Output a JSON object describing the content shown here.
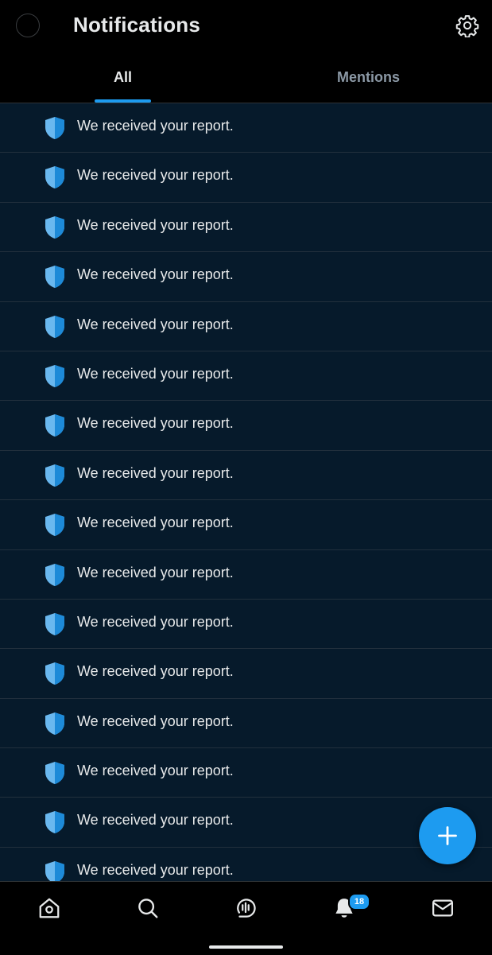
{
  "header": {
    "title": "Notifications",
    "avatar_icon": "profile-avatar-icon",
    "settings_icon": "gear-icon"
  },
  "tabs": [
    {
      "label": "All",
      "active": true
    },
    {
      "label": "Mentions",
      "active": false
    }
  ],
  "notifications": [
    {
      "icon": "shield-icon",
      "text": "We received your report."
    },
    {
      "icon": "shield-icon",
      "text": "We received your report."
    },
    {
      "icon": "shield-icon",
      "text": "We received your report."
    },
    {
      "icon": "shield-icon",
      "text": "We received your report."
    },
    {
      "icon": "shield-icon",
      "text": "We received your report."
    },
    {
      "icon": "shield-icon",
      "text": "We received your report."
    },
    {
      "icon": "shield-icon",
      "text": "We received your report."
    },
    {
      "icon": "shield-icon",
      "text": "We received your report."
    },
    {
      "icon": "shield-icon",
      "text": "We received your report."
    },
    {
      "icon": "shield-icon",
      "text": "We received your report."
    },
    {
      "icon": "shield-icon",
      "text": "We received your report."
    },
    {
      "icon": "shield-icon",
      "text": "We received your report."
    },
    {
      "icon": "shield-icon",
      "text": "We received your report."
    },
    {
      "icon": "shield-icon",
      "text": "We received your report."
    },
    {
      "icon": "shield-icon",
      "text": "We received your report."
    },
    {
      "icon": "shield-icon",
      "text": "We received your report."
    }
  ],
  "fab": {
    "icon": "plus-icon"
  },
  "bottom_nav": {
    "items": [
      {
        "icon": "home-icon"
      },
      {
        "icon": "search-icon"
      },
      {
        "icon": "spaces-microphone-icon"
      },
      {
        "icon": "bell-icon"
      },
      {
        "icon": "mail-icon"
      }
    ],
    "notification_badge": "18"
  },
  "colors": {
    "accent": "#1d9bf0",
    "shield_light": "#6ab8ef",
    "shield_dark": "#1d8ad8",
    "row_background": "#061a2b",
    "background": "#000000"
  }
}
